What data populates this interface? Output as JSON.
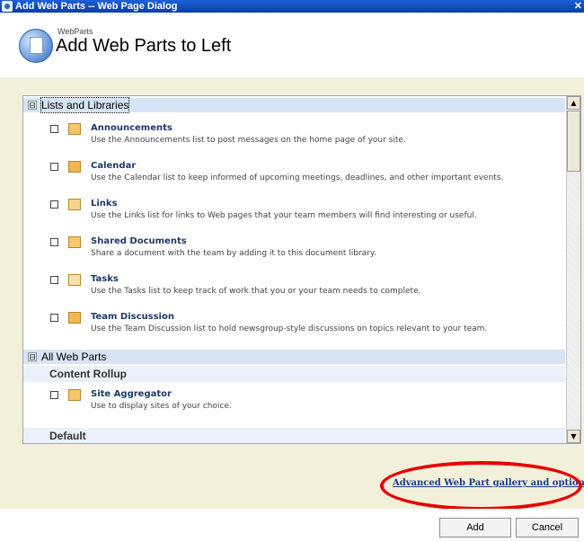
{
  "window": {
    "title": "Add Web Parts -- Web Page Dialog"
  },
  "header": {
    "subtitle": "WebParts",
    "title": "Add Web Parts to Left"
  },
  "categories": [
    {
      "label": "Lists and Libraries",
      "toggle": "⊟"
    },
    {
      "label": "All Web Parts",
      "toggle": "⊟"
    }
  ],
  "subcategories": [
    {
      "label": "Content Rollup"
    },
    {
      "label": "Default"
    }
  ],
  "lists_items": [
    {
      "name": "Announcements",
      "desc": "Use the Announcements list to post messages on the home page of your site.",
      "icon": "announcements-icon"
    },
    {
      "name": "Calendar",
      "desc": "Use the Calendar list to keep informed of upcoming meetings, deadlines, and other important events.",
      "icon": "calendar-icon"
    },
    {
      "name": "Links",
      "desc": "Use the Links list for links to Web pages that your team members will find interesting or useful.",
      "icon": "links-icon"
    },
    {
      "name": "Shared Documents",
      "desc": "Share a document with the team by adding it to this document library.",
      "icon": "document-library-icon"
    },
    {
      "name": "Tasks",
      "desc": "Use the Tasks list to keep track of work that you or your team needs to complete.",
      "icon": "tasks-icon"
    },
    {
      "name": "Team Discussion",
      "desc": "Use the Team Discussion list to hold newsgroup-style discussions on topics relevant to your team.",
      "icon": "discussion-icon"
    }
  ],
  "rollup_items": [
    {
      "name": "Site Aggregator",
      "desc": "Use to display sites of your choice.",
      "icon": "site-aggregator-icon"
    }
  ],
  "advanced_link": "Advanced Web Part gallery and options",
  "buttons": {
    "add": "Add",
    "cancel": "Cancel"
  },
  "scroll": {
    "up": "▲",
    "down": "▼"
  },
  "colors": {
    "titlebar": "#0a3fa8",
    "category_bg": "#d7e4f4",
    "band": "#f3f0d9",
    "highlight_ellipse": "#e80000",
    "link": "#1a3c8c"
  }
}
